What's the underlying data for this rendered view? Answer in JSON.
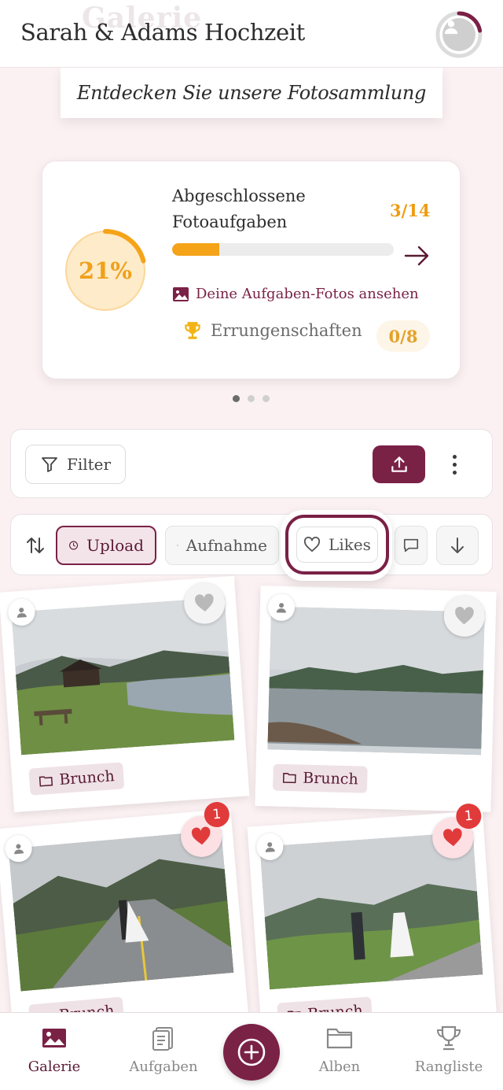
{
  "header": {
    "ghost_title": "Galerie",
    "title": "Sarah & Adams Hochzeit"
  },
  "subtitle": "Entdecken Sie unsere Fotosammlung",
  "progress_card": {
    "percent_label": "21%",
    "percent_value": 0.21,
    "task_title": "Abgeschlossene Fotoaufgaben",
    "task_count": "3/14",
    "task_progress": 0.2143,
    "photos_link": "Deine Aufgaben-Fotos ansehen",
    "achievements_label": "Errungenschaften",
    "achievements_count": "0/8"
  },
  "carousel": {
    "active_index": 0,
    "count": 3
  },
  "filter_bar": {
    "filter_label": "Filter"
  },
  "sort_bar": {
    "chips": [
      "Upload",
      "Aufnahme",
      "Likes"
    ],
    "active": "Upload",
    "highlighted": "Likes"
  },
  "photos": [
    {
      "album": "Brunch",
      "liked": false,
      "likes": "",
      "scene": "lake-cabin"
    },
    {
      "album": "Brunch",
      "liked": false,
      "likes": "",
      "scene": "lake"
    },
    {
      "album": "Brunch",
      "liked": true,
      "likes": "1",
      "scene": "road-couple"
    },
    {
      "album": "Brunch",
      "liked": true,
      "likes": "1",
      "scene": "field-couple"
    }
  ],
  "bottom_nav": {
    "items": [
      "Galerie",
      "Aufgaben",
      "Alben",
      "Rangliste"
    ],
    "active": "Galerie"
  },
  "colors": {
    "brand": "#7a2146",
    "accent": "#f5a319",
    "like": "#e13a3a",
    "background": "#fbf1f3"
  }
}
